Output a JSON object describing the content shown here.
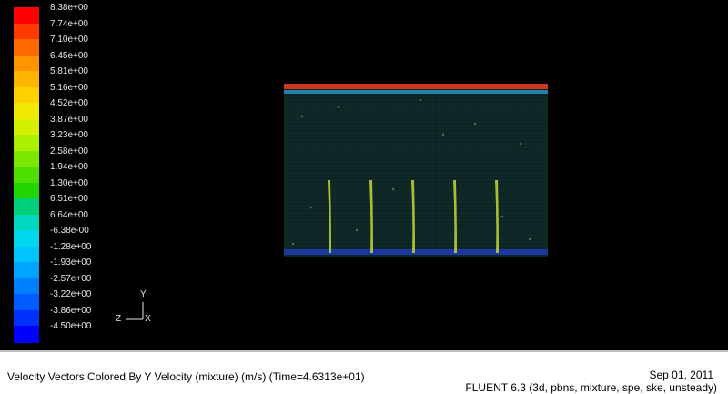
{
  "legend": {
    "labels": [
      "8.38e+00",
      "7.74e+00",
      "7.10e+00",
      "6.45e+00",
      "5.81e+00",
      "5.16e+00",
      "4.52e+00",
      "3.87e+00",
      "3.23e+00",
      "2.58e+00",
      "1.94e+00",
      "1.30e+00",
      "6.51e+00",
      "6.64e+00",
      "-6.38e-00",
      "-1.28e+00",
      "-1.93e+00",
      "-2.57e+00",
      "-3.22e+00",
      "-3.86e+00",
      "-4.50e+00"
    ],
    "colors": [
      "#ff0000",
      "#ff3a00",
      "#ff6a00",
      "#ff9400",
      "#ffb400",
      "#ffd000",
      "#f0e800",
      "#d4f000",
      "#a8f000",
      "#7ae800",
      "#4ede00",
      "#22d400",
      "#00d07a",
      "#00d8c0",
      "#00d8f0",
      "#00c4ff",
      "#00a4ff",
      "#0080ff",
      "#005cff",
      "#0032ff",
      "#0000ff"
    ]
  },
  "axes": {
    "vertical": "Y",
    "horizontal_left": "Z",
    "horizontal_right": "X"
  },
  "info": {
    "caption": "Velocity Vectors Colored By Y Velocity  (mixture)  (m/s)    (Time=4.6313e+01)",
    "date": "Sep 01, 2011",
    "version": "FLUENT 6.3 (3d, pbns, mixture, spe, ske,  unsteady)"
  },
  "field": {
    "top_band_color": "#c83a1a",
    "second_band_color": "#2a8ab8",
    "bottom_band_color": "#1a3aa8",
    "body_color": "#0f2a2a",
    "jet_color": "#c8d830"
  }
}
